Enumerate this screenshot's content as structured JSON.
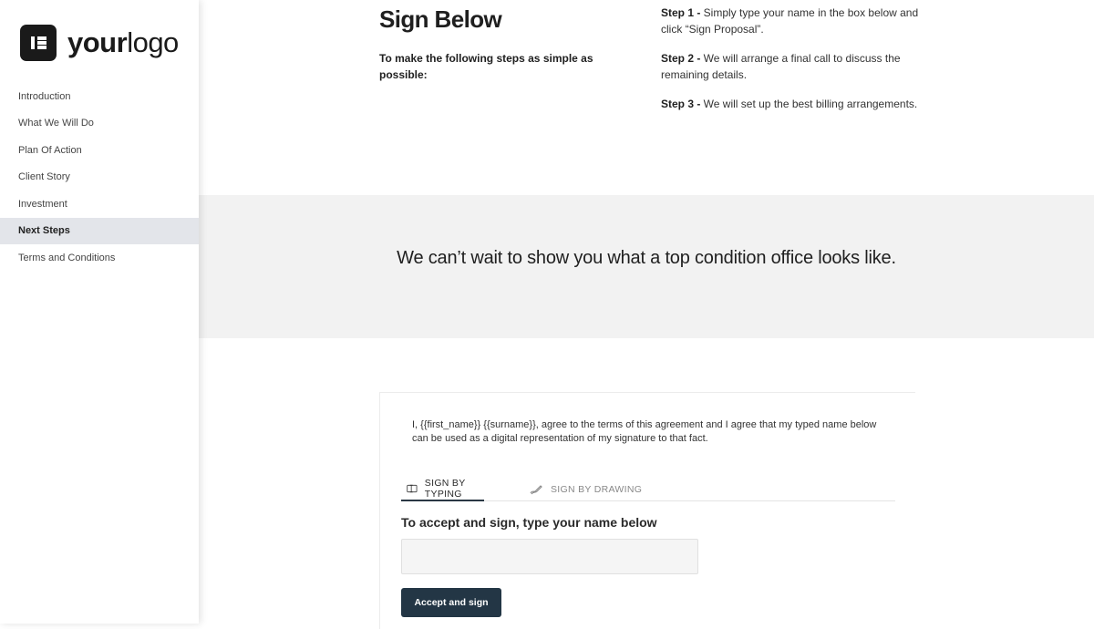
{
  "brand": {
    "logo_bold": "your",
    "logo_light": "logo"
  },
  "nav": {
    "items": [
      {
        "label": "Introduction"
      },
      {
        "label": "What We Will Do"
      },
      {
        "label": "Plan Of Action"
      },
      {
        "label": "Client Story"
      },
      {
        "label": "Investment"
      },
      {
        "label": "Next Steps",
        "active": true
      },
      {
        "label": "Terms and Conditions"
      }
    ]
  },
  "sign_section": {
    "title": "Sign Below",
    "intro": "To make the following steps as simple as possible:",
    "steps": [
      {
        "label": "Step 1 -",
        "text": " Simply type your name in the box below and click “Sign Proposal”."
      },
      {
        "label": "Step 2 -",
        "text": " We will arrange a final call to discuss the remaining details."
      },
      {
        "label": "Step 3 -",
        "text": " We will set up the best billing arrangements."
      }
    ]
  },
  "banner": {
    "text": "We can’t wait to show you what a top condition office looks like."
  },
  "signature": {
    "agreement": "I, {{first_name}} {{surname}}, agree to the terms of this agreement and I agree that my typed name below can be used as a digital representation of my signature to that fact.",
    "tabs": [
      {
        "label": "SIGN BY TYPING",
        "icon": "keyboard-icon",
        "active": true
      },
      {
        "label": "SIGN BY DRAWING",
        "icon": "pen-icon",
        "active": false
      }
    ],
    "accept_label": "To accept and sign, type your name below",
    "input_value": "",
    "input_placeholder": "",
    "button_label": "Accept and sign"
  },
  "colors": {
    "button_bg": "#233645",
    "active_nav_bg": "#e3e5ea",
    "banner_bg": "#f2f2f2"
  }
}
